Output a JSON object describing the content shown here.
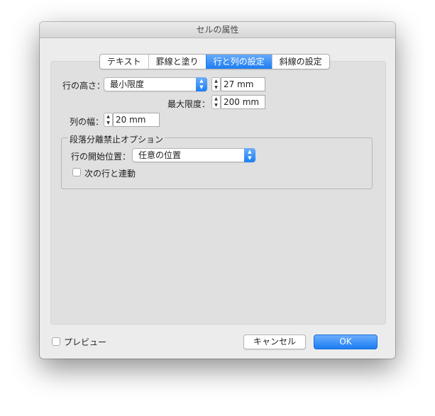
{
  "window": {
    "title": "セルの属性"
  },
  "tabs": [
    {
      "label": "テキスト",
      "active": false
    },
    {
      "label": "罫線と塗り",
      "active": false
    },
    {
      "label": "行と列の設定",
      "active": true
    },
    {
      "label": "斜線の設定",
      "active": false
    }
  ],
  "row_height": {
    "label": "行の高さ：",
    "mode": "最小限度",
    "value": "27 mm",
    "max_label": "最大限度：",
    "max_value": "200 mm"
  },
  "column_width": {
    "label": "列の幅：",
    "value": "20 mm"
  },
  "keep_options": {
    "title": "段落分離禁止オプション",
    "start_row_label": "行の開始位置：",
    "start_row_value": "任意の位置",
    "keep_with_next_label": "次の行と連動",
    "keep_with_next_checked": false
  },
  "footer": {
    "preview_label": "プレビュー",
    "preview_checked": false,
    "cancel_label": "キャンセル",
    "ok_label": "OK"
  },
  "colors": {
    "accent": "#1c7df4",
    "dialog_bg": "#ececec",
    "panel_bg": "#e0e0e0"
  },
  "icons": {
    "select_arrows": "updown-chevron-icon",
    "stepper": "stepper-arrows-icon"
  }
}
